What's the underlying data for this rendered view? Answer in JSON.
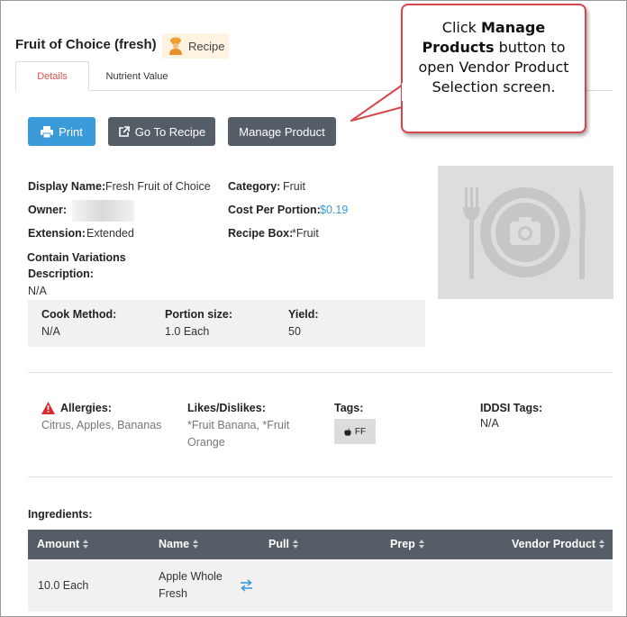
{
  "header": {
    "title": "Fruit of Choice (fresh)",
    "badge_label": "Recipe"
  },
  "tabs": [
    {
      "label": "Details",
      "active": true
    },
    {
      "label": "Nutrient Value",
      "active": false
    }
  ],
  "toolbar": {
    "print_label": "Print",
    "goto_label": "Go To Recipe",
    "manage_label": "Manage Product"
  },
  "callout": {
    "text_before": "Click ",
    "bold": "Manage Products",
    "text_after": " button to open Vendor Product Selection screen."
  },
  "details": {
    "display_name_label": "Display Name:",
    "display_name_value": "Fresh Fruit of Choice",
    "owner_label": "Owner:",
    "extension_label": "Extension:",
    "extension_value": "Extended",
    "category_label": "Category:",
    "category_value": "Fruit",
    "cost_label": "Cost Per Portion:",
    "cost_value": "$0.19",
    "recipe_box_label": "Recipe Box:",
    "recipe_box_value": "*Fruit",
    "contain_variations_label": "Contain Variations",
    "description_label": "Description:",
    "description_value": "N/A"
  },
  "cook": {
    "method_label": "Cook Method:",
    "method_value": "N/A",
    "portion_label": "Portion size:",
    "portion_value": "1.0 Each",
    "yield_label": "Yield:",
    "yield_value": "50"
  },
  "attributes": {
    "allergies_label": "Allergies:",
    "allergies_value": "Citrus, Apples, Bananas",
    "likes_label": "Likes/Dislikes:",
    "likes_value_line1": "*Fruit Banana, *Fruit",
    "likes_value_line2": "Orange",
    "tags_label": "Tags:",
    "tag_chip": "FF",
    "iddsi_label": "IDDSI Tags:",
    "iddsi_value": "N/A"
  },
  "ingredients": {
    "heading": "Ingredients:",
    "columns": [
      "Amount",
      "Name",
      "Pull",
      "Prep",
      "Vendor Product"
    ],
    "rows": [
      {
        "amount": "10.0 Each",
        "name_line1": "Apple Whole",
        "name_line2": "Fresh",
        "pull": "",
        "prep": "",
        "vendor_product": ""
      }
    ]
  },
  "colors": {
    "primary": "#3b9ad9",
    "dark_button": "#555e66",
    "accent_red": "#d9534f",
    "badge_bg": "#fdf3e0"
  }
}
